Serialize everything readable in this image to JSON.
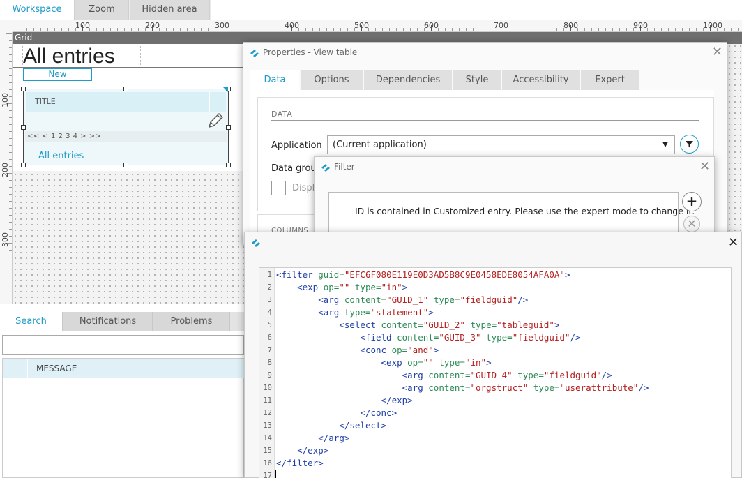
{
  "top_tabs": [
    "Workspace",
    "Zoom",
    "Hidden area"
  ],
  "ruler_top": [
    "100",
    "200",
    "300",
    "400",
    "500",
    "600",
    "700",
    "800",
    "900",
    "1000"
  ],
  "ruler_left": [
    "100",
    "200",
    "300"
  ],
  "canvas": {
    "grid_label": "Grid",
    "page_title": "All entries",
    "new_button": "New",
    "table": {
      "header": "TITLE",
      "pager": "<< < 1 2 3 4 > >>",
      "link": "All entries"
    }
  },
  "bottom_tabs": [
    "Search",
    "Notifications",
    "Problems"
  ],
  "messages": {
    "column": "MESSAGE"
  },
  "properties_dialog": {
    "title": "Properties - View table",
    "tabs": [
      "Data",
      "Options",
      "Dependencies",
      "Style",
      "Accessibility",
      "Expert"
    ],
    "section_label": "DATA",
    "application_label": "Application",
    "application_value": "(Current application)",
    "data_group_label": "Data group",
    "checkbox_label": "Display",
    "columns_label": "COLUMNS"
  },
  "filter_dialog": {
    "title": "Filter",
    "message": "ID is contained in Customized entry. Please use the expert mode to change it."
  },
  "expert_dialog": {
    "lines": [
      [
        [
          "t",
          "<filter "
        ],
        [
          "a",
          "guid="
        ],
        [
          "v",
          "\"EFC6F080E119E0D3AD5B8C9E0458EDE8054AFA0A\""
        ],
        [
          "t",
          ">"
        ]
      ],
      [
        [
          "s",
          "    "
        ],
        [
          "t",
          "<exp "
        ],
        [
          "a",
          "op="
        ],
        [
          "v",
          "\"\""
        ],
        [
          "s",
          " "
        ],
        [
          "a",
          "type="
        ],
        [
          "v",
          "\"in\""
        ],
        [
          "t",
          ">"
        ]
      ],
      [
        [
          "s",
          "        "
        ],
        [
          "t",
          "<arg "
        ],
        [
          "a",
          "content="
        ],
        [
          "v",
          "\"GUID_1\""
        ],
        [
          "s",
          " "
        ],
        [
          "a",
          "type="
        ],
        [
          "v",
          "\"fieldguid\""
        ],
        [
          "t",
          "/>"
        ]
      ],
      [
        [
          "s",
          "        "
        ],
        [
          "t",
          "<arg "
        ],
        [
          "a",
          "type="
        ],
        [
          "v",
          "\"statement\""
        ],
        [
          "t",
          ">"
        ]
      ],
      [
        [
          "s",
          "            "
        ],
        [
          "t",
          "<select "
        ],
        [
          "a",
          "content="
        ],
        [
          "v",
          "\"GUID_2\""
        ],
        [
          "s",
          " "
        ],
        [
          "a",
          "type="
        ],
        [
          "v",
          "\"tableguid\""
        ],
        [
          "t",
          ">"
        ]
      ],
      [
        [
          "s",
          "                "
        ],
        [
          "t",
          "<field "
        ],
        [
          "a",
          "content="
        ],
        [
          "v",
          "\"GUID_3\""
        ],
        [
          "s",
          " "
        ],
        [
          "a",
          "type="
        ],
        [
          "v",
          "\"fieldguid\""
        ],
        [
          "t",
          "/>"
        ]
      ],
      [
        [
          "s",
          "                "
        ],
        [
          "t",
          "<conc "
        ],
        [
          "a",
          "op="
        ],
        [
          "v",
          "\"and\""
        ],
        [
          "t",
          ">"
        ]
      ],
      [
        [
          "s",
          "                    "
        ],
        [
          "t",
          "<exp "
        ],
        [
          "a",
          "op="
        ],
        [
          "v",
          "\"\""
        ],
        [
          "s",
          " "
        ],
        [
          "a",
          "type="
        ],
        [
          "v",
          "\"in\""
        ],
        [
          "t",
          ">"
        ]
      ],
      [
        [
          "s",
          "                        "
        ],
        [
          "t",
          "<arg "
        ],
        [
          "a",
          "content="
        ],
        [
          "v",
          "\"GUID_4\""
        ],
        [
          "s",
          " "
        ],
        [
          "a",
          "type="
        ],
        [
          "v",
          "\"fieldguid\""
        ],
        [
          "t",
          "/>"
        ]
      ],
      [
        [
          "s",
          "                        "
        ],
        [
          "t",
          "<arg "
        ],
        [
          "a",
          "content="
        ],
        [
          "v",
          "\"orgstruct\""
        ],
        [
          "s",
          " "
        ],
        [
          "a",
          "type="
        ],
        [
          "v",
          "\"userattribute\""
        ],
        [
          "t",
          "/>"
        ]
      ],
      [
        [
          "s",
          "                    "
        ],
        [
          "t",
          "</exp>"
        ]
      ],
      [
        [
          "s",
          "                "
        ],
        [
          "t",
          "</conc>"
        ]
      ],
      [
        [
          "s",
          "            "
        ],
        [
          "t",
          "</select>"
        ]
      ],
      [
        [
          "s",
          "        "
        ],
        [
          "t",
          "</arg>"
        ]
      ],
      [
        [
          "s",
          "    "
        ],
        [
          "t",
          "</exp>"
        ]
      ],
      [
        [
          "t",
          "</filter>"
        ]
      ],
      []
    ]
  },
  "colors": {
    "accent": "#1e9bc8",
    "value": "#b52020",
    "attr": "#2e8b57",
    "tag": "#1f3fa8"
  }
}
